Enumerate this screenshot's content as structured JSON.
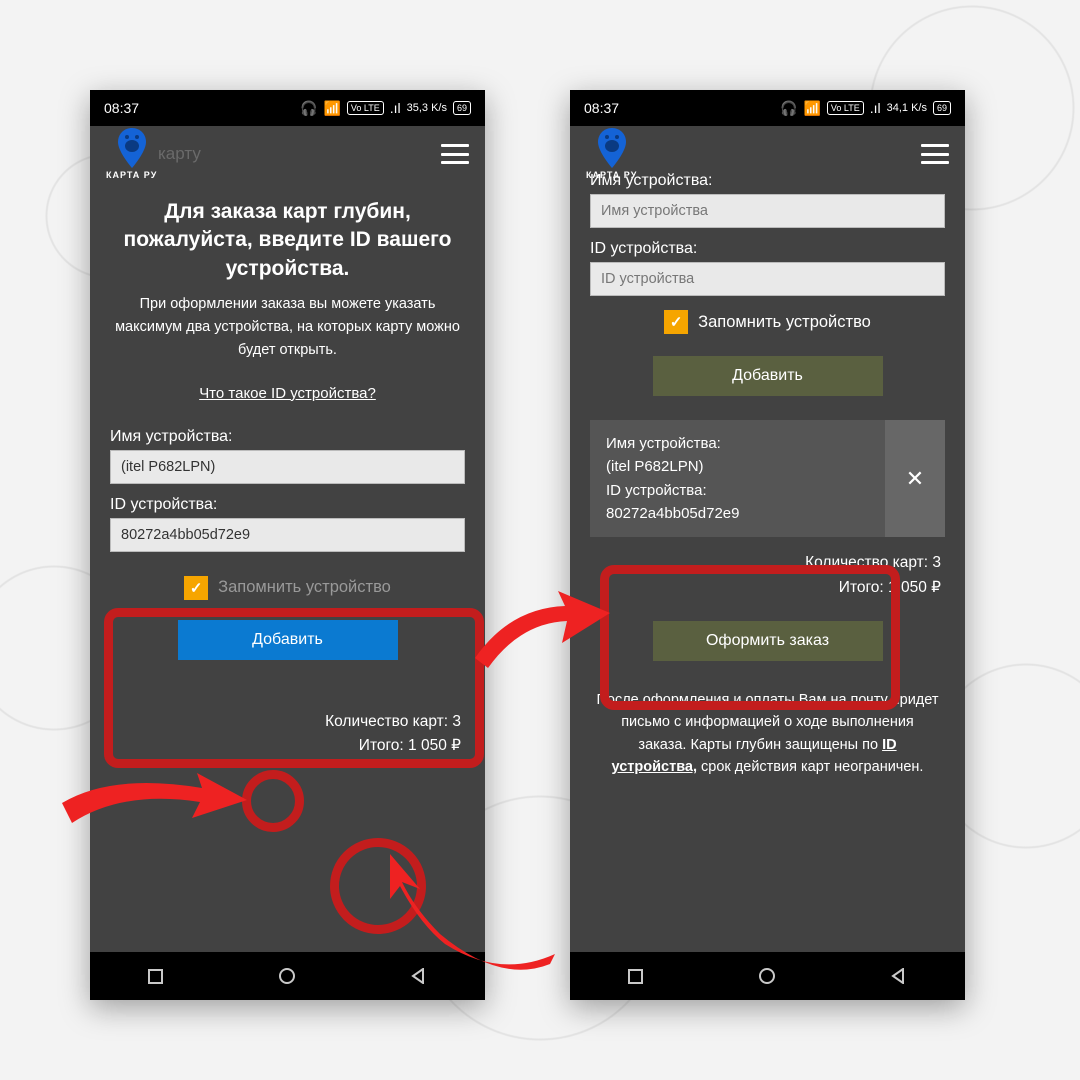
{
  "status": {
    "time": "08:37",
    "net1": "35,3 K/s",
    "net2": "34,1 K/s",
    "lte": "Vo LTE",
    "battery": "69"
  },
  "header": {
    "logo_text": "КАРТА РУ",
    "faded_word_left": "карту"
  },
  "left": {
    "heading": "Для заказа карт глубин, пожалуйста, введите ID вашего устройства.",
    "subheading": "При оформлении заказа вы можете указать максимум два устройства, на которых карту можно будет открыть.",
    "what_is_link": "Что такое ID устройства?",
    "name_label": "Имя устройства:",
    "name_value": "(itel P682LPN)",
    "id_label": "ID устройства:",
    "id_value": "80272a4bb05d72e9",
    "remember_label": "Запомнить устройство",
    "add_button": "Добавить",
    "qty_label": "Количество карт: 3",
    "total_label": "Итого: 1 050 ₽"
  },
  "right": {
    "name_label": "Имя устройства:",
    "name_placeholder": "Имя устройства",
    "id_label": "ID устройства:",
    "id_placeholder": "ID устройства",
    "remember_label": "Запомнить устройство",
    "add_button": "Добавить",
    "card_name_label": "Имя устройства:",
    "card_name_value": "(itel P682LPN)",
    "card_id_label": "ID устройства:",
    "card_id_value": "80272a4bb05d72e9",
    "qty_label": "Количество карт: 3",
    "total_label": "Итого: 1 050 ₽",
    "checkout_button": "Оформить заказ",
    "footer_a": "После оформления и оплаты Вам на почту придет письмо с информацией о ходе выполнения заказа. Карты глубин защищены по ",
    "footer_ul": "ID устройства,",
    "footer_b": " срок действия карт неограничен."
  }
}
